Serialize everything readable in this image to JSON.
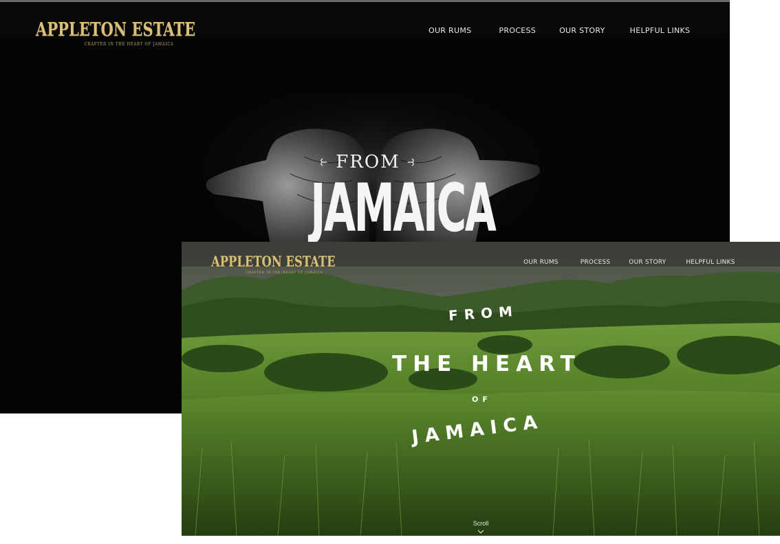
{
  "brand": {
    "logo_text": "APPLETON ESTATE",
    "logo_tagline": "CRAFTED IN THE HEART OF JAMAICA",
    "logo_color": "#d8c07a"
  },
  "back_screen": {
    "nav": [
      "OUR RUMS",
      "PROCESS",
      "OUR STORY",
      "HELPFUL LINKS"
    ],
    "hero": {
      "line1": "FROM",
      "line2": "JAMAICA"
    },
    "background": "#050505"
  },
  "front_screen": {
    "nav": [
      "OUR RUMS",
      "PROCESS",
      "OUR STORY",
      "HELPFUL LINKS"
    ],
    "hero": {
      "line1": "FROM",
      "line2": "THE HEART",
      "line3": "OF",
      "line4": "JAMAICA"
    },
    "scroll_label": "Scroll",
    "icons": {
      "scroll": "chevron-down-icon",
      "swash": "swash-ornament-icon"
    }
  }
}
